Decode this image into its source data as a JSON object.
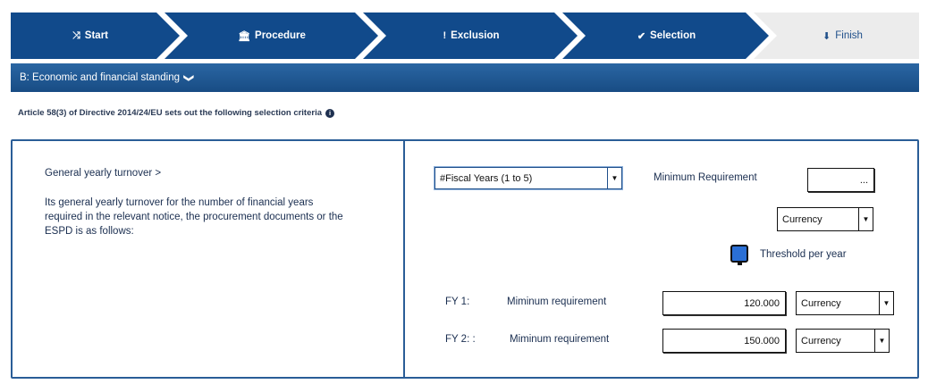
{
  "wizard": {
    "steps": [
      {
        "icon": "⤨",
        "label": "Start",
        "active": true
      },
      {
        "icon": "🏛",
        "label": "Procedure",
        "active": true
      },
      {
        "icon": "!",
        "label": "Exclusion",
        "active": true
      },
      {
        "icon": "✔",
        "label": "Selection",
        "active": true
      },
      {
        "icon": "⬇",
        "label": "Finish",
        "active": false
      }
    ]
  },
  "section": {
    "title": "B: Economic and financial standing",
    "chevron": "❯"
  },
  "article": {
    "text": "Article 58(3) of Directive 2014/24/EU sets out the following selection criteria",
    "info": "i"
  },
  "criterion": {
    "title": "General yearly turnover >",
    "description": "Its general yearly turnover for the number of financial years required in the relevant notice, the procurement documents or the ESPD is as follows:",
    "fiscal_select": "#Fiscal Years (1 to 5)",
    "min_req_label": "Minimum Requirement",
    "min_req_value": "...",
    "currency_select": "Currency",
    "threshold_label": "Threshold per year",
    "rows": [
      {
        "fy": "FY 1:",
        "label": "Miminum requirement",
        "value": "120.000",
        "currency": "Currency"
      },
      {
        "fy": "FY 2: :",
        "label": "Miminum requirement",
        "value": "150.000",
        "currency": "Currency"
      }
    ]
  },
  "colors": {
    "step_active": "#114a8b",
    "step_inactive": "#ececec",
    "panel_border": "#2a5d97"
  }
}
